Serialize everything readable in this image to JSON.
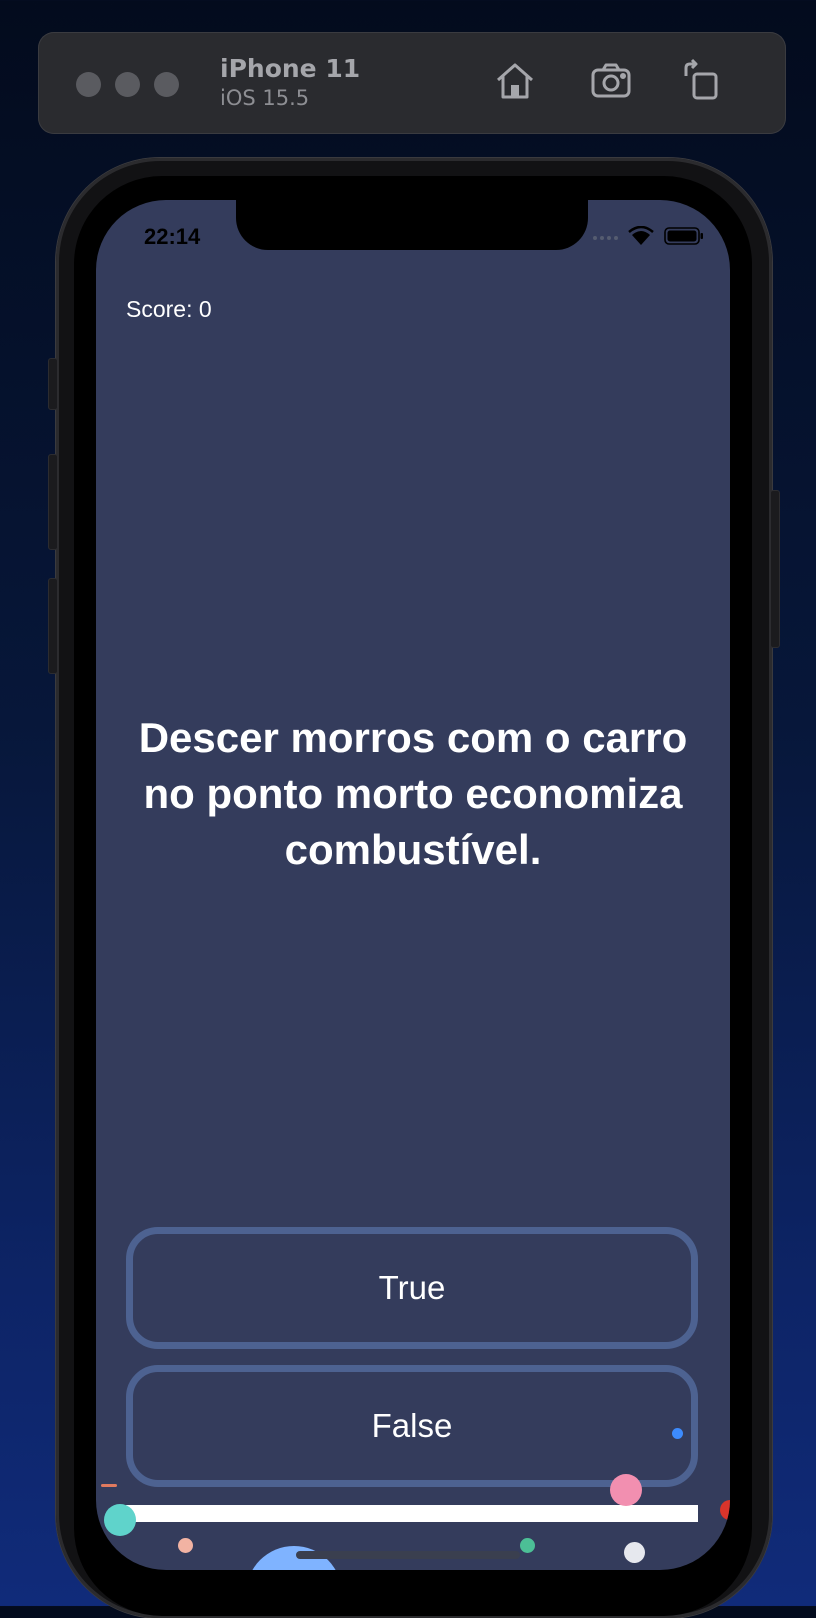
{
  "simulator": {
    "device_name": "iPhone 11",
    "os_version": "iOS 15.5",
    "toolbar_icons": [
      "home-icon",
      "screenshot-icon",
      "rotate-icon"
    ]
  },
  "status_bar": {
    "time": "22:14"
  },
  "quiz": {
    "score_label": "Score: 0",
    "question": "Descer morros com o carro no ponto morto economiza combustível.",
    "answers": [
      {
        "label": "True"
      },
      {
        "label": "False"
      }
    ],
    "progress_fraction": 1.0
  },
  "colors": {
    "screen_background": "#343c5c",
    "button_border": "#4d6291",
    "text": "#ffffff"
  }
}
